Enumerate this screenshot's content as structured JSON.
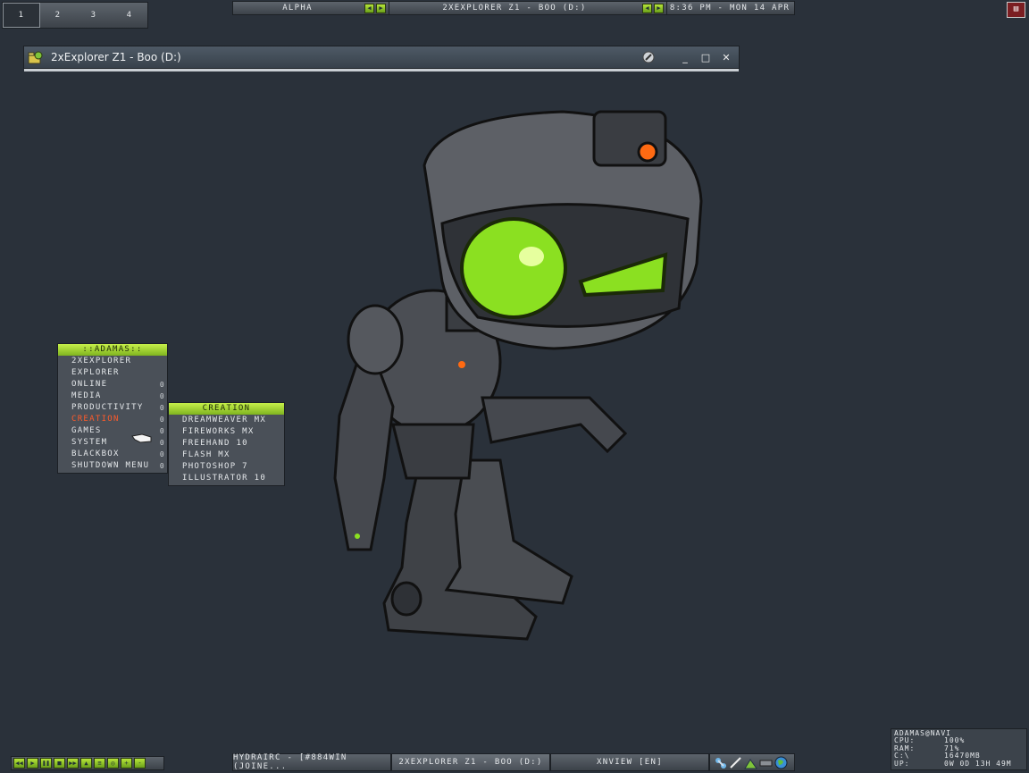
{
  "workspaces": [
    "1",
    "2",
    "3",
    "4"
  ],
  "active_workspace": 0,
  "toolbar": {
    "workspace_name": "Alpha",
    "window_title": "2xExplorer Z1 - Boo (D:)",
    "clock": "8:36 PM - Mon 14 Apr"
  },
  "window": {
    "title": "2xExplorer Z1 - Boo (D:)",
    "minimize": "_",
    "maximize": "□",
    "close": "✕"
  },
  "menu": {
    "header": "::Adamas::",
    "items": [
      {
        "label": "2xExplorer",
        "submenu": ""
      },
      {
        "label": "Explorer",
        "submenu": ""
      },
      {
        "label": "Online",
        "submenu": "0"
      },
      {
        "label": "Media",
        "submenu": "0"
      },
      {
        "label": "Productivity",
        "submenu": "0"
      },
      {
        "label": "Creation",
        "submenu": "0"
      },
      {
        "label": "Games",
        "submenu": "0"
      },
      {
        "label": "System",
        "submenu": "0"
      },
      {
        "label": "Blackbox",
        "submenu": "0"
      },
      {
        "label": "Shutdown Menu",
        "submenu": "0"
      }
    ],
    "selected_index": 5
  },
  "submenu": {
    "header": "Creation",
    "items": [
      "Dreamweaver MX",
      "Fireworks MX",
      "Freehand 10",
      "Flash MX",
      "Photoshop 7",
      "Illustrator 10"
    ]
  },
  "media_controls": [
    "rewind-icon",
    "play-icon",
    "pause-icon",
    "stop-icon",
    "fast-forward-icon",
    "open-icon",
    "playlist-icon",
    "options-icon",
    "volume-up-icon",
    "volume-down-icon"
  ],
  "taskbar": {
    "tasks": [
      {
        "label": "HydraIRC - [#884win (Joine...",
        "active": false
      },
      {
        "label": "2xExplorer Z1 - Boo (D:)",
        "active": true
      },
      {
        "label": "XnView [EN]",
        "active": false
      }
    ],
    "tray_icons": [
      "network-icon",
      "pen-icon",
      "chart-icon",
      "memory-icon",
      "globe-icon"
    ]
  },
  "stats": {
    "title": "adamas@navi",
    "rows": [
      {
        "label": "CPU:",
        "value": "100%"
      },
      {
        "label": "RAM:",
        "value": "71%"
      },
      {
        "label": "C:\\",
        "value": "16470MB"
      },
      {
        "label": "UP:",
        "value": "0w 0d 13h 49m"
      }
    ]
  },
  "colors": {
    "desktop": "#2a313a",
    "accent_green": "#9bd22a",
    "highlight_orange": "#ff5a2a"
  }
}
